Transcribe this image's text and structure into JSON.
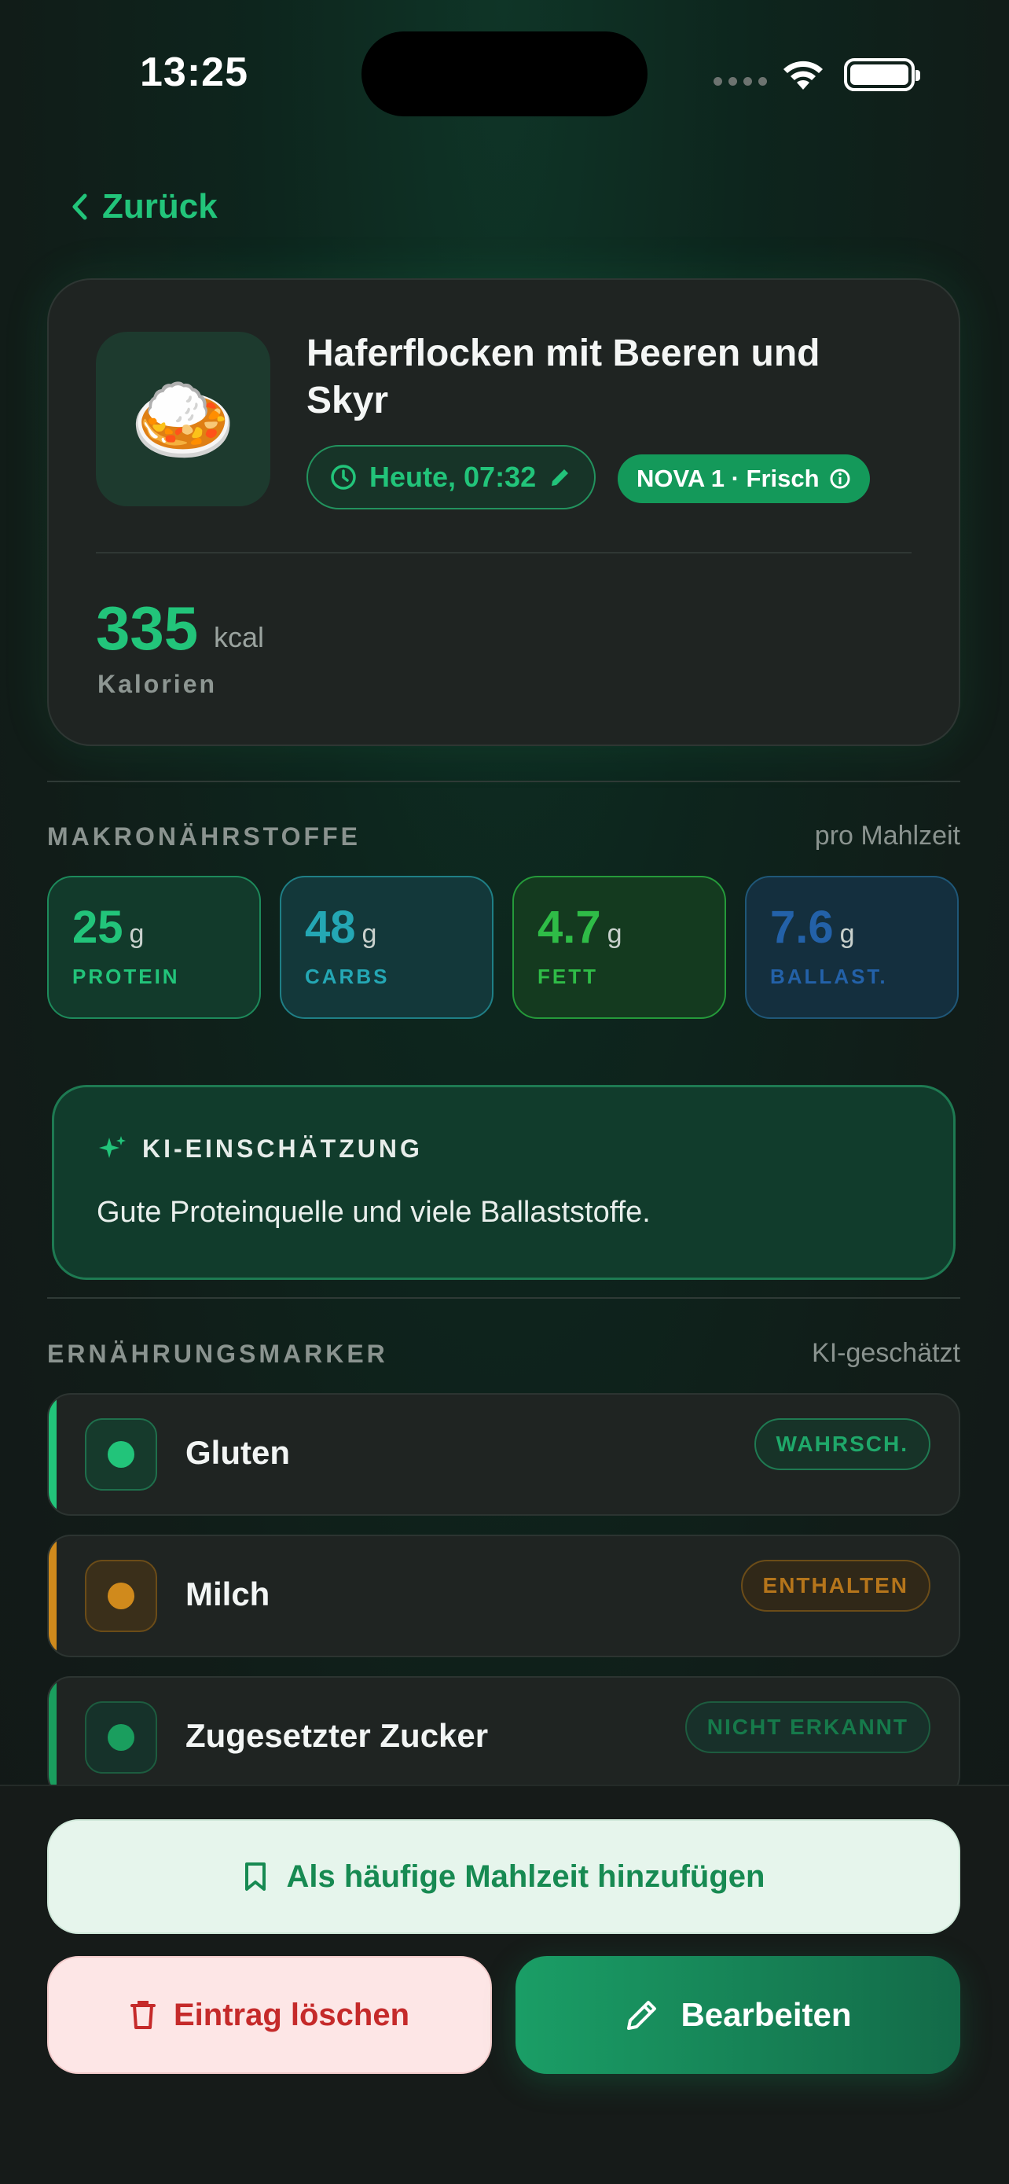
{
  "status": {
    "time": "13:25"
  },
  "nav": {
    "back_label": "Zurück"
  },
  "meal": {
    "emoji": "🍛",
    "title": "Haferflocken mit Beeren und Skyr",
    "time_label": "Heute, 07:32",
    "nova_label": "NOVA 1 · Frisch",
    "kcal_value": "335",
    "kcal_unit": "kcal",
    "kcal_label": "Kalorien"
  },
  "macros": {
    "title": "MAKRONÄHRSTOFFE",
    "meta": "pro Mahlzeit",
    "items": [
      {
        "value": "25",
        "unit": "g",
        "label": "PROTEIN",
        "color": "#22c47a"
      },
      {
        "value": "48",
        "unit": "g",
        "label": "CARBS",
        "color": "#24a7b4"
      },
      {
        "value": "4.7",
        "unit": "g",
        "label": "FETT",
        "color": "#2fbc47"
      },
      {
        "value": "7.6",
        "unit": "g",
        "label": "BALLAST.",
        "color": "#2361a8"
      }
    ]
  },
  "ai": {
    "title": "KI-EINSCHÄTZUNG",
    "text": "Gute Proteinquelle und viele Ballaststoffe."
  },
  "markers": {
    "title": "ERNÄHRUNGSMARKER",
    "meta": "KI-geschätzt",
    "items": [
      {
        "name": "Gluten",
        "badge": "WAHRSCH.",
        "color": "#22c47a"
      },
      {
        "name": "Milch",
        "badge": "ENTHALTEN",
        "color": "#d08a1c"
      },
      {
        "name": "Zugesetzter Zucker",
        "badge": "NICHT ERKANNT",
        "color": "#1a9e5e"
      }
    ]
  },
  "actions": {
    "favorite_label": "Als häufige Mahlzeit hinzufügen",
    "delete_label": "Eintrag löschen",
    "edit_label": "Bearbeiten"
  }
}
